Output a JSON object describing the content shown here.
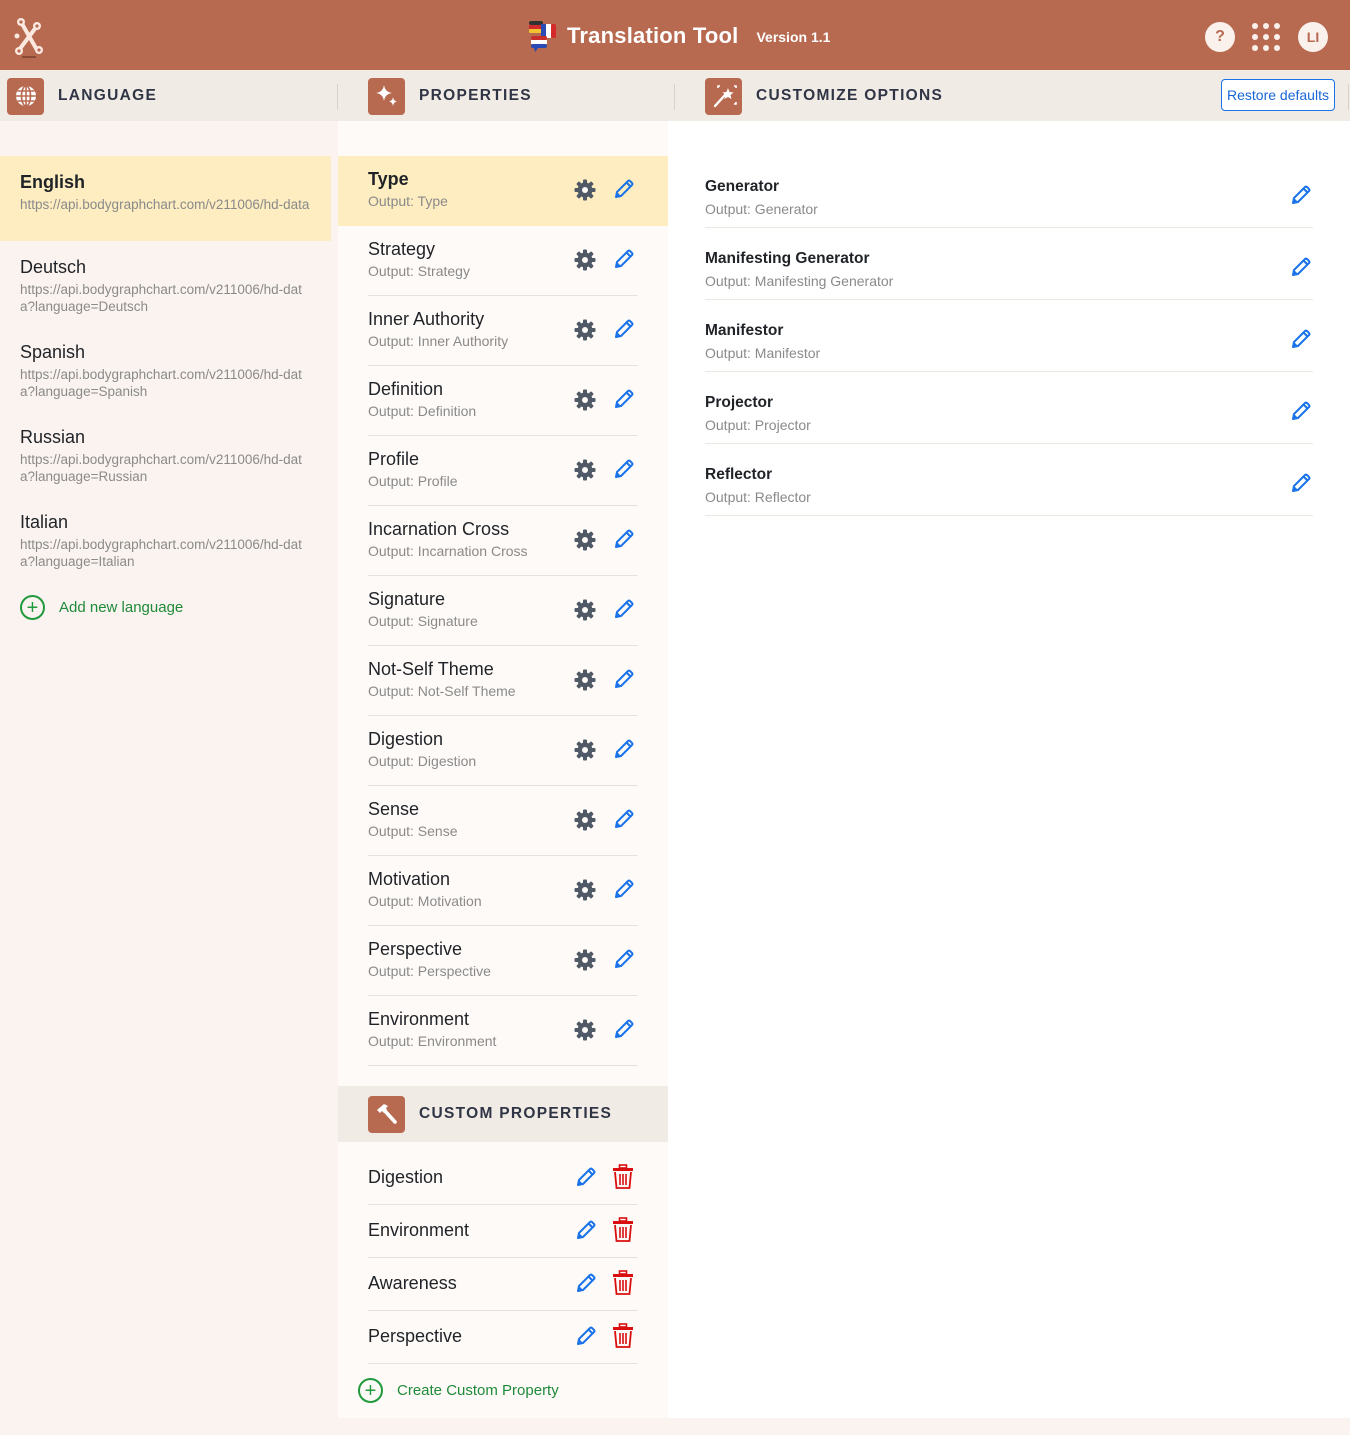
{
  "app": {
    "title": "Translation Tool",
    "version": "Version 1.1",
    "help_label": "?",
    "avatar_initials": "LI",
    "brand_color": "#b76a50"
  },
  "sections": {
    "language": {
      "title": "LANGUAGE",
      "icon": "globe-icon"
    },
    "properties": {
      "title": "PROPERTIES",
      "icon": "sparkles-icon"
    },
    "customize": {
      "title": "CUSTOMIZE OPTIONS",
      "icon": "magic-wand-icon",
      "restore_label": "Restore defaults"
    },
    "custom_properties": {
      "title": "CUSTOM PROPERTIES",
      "icon": "hammer-icon"
    }
  },
  "languages": [
    {
      "name": "English",
      "url": "https://api.bodygraphchart.com/v211006/hd-data",
      "selected": true
    },
    {
      "name": "Deutsch",
      "url": "https://api.bodygraphchart.com/v211006/hd-data?language=Deutsch",
      "selected": false
    },
    {
      "name": "Spanish",
      "url": "https://api.bodygraphchart.com/v211006/hd-data?language=Spanish",
      "selected": false
    },
    {
      "name": "Russian",
      "url": "https://api.bodygraphchart.com/v211006/hd-data?language=Russian",
      "selected": false
    },
    {
      "name": "Italian",
      "url": "https://api.bodygraphchart.com/v211006/hd-data?language=Italian",
      "selected": false
    }
  ],
  "add_language_label": "Add new language",
  "properties": [
    {
      "name": "Type",
      "output": "Output: Type",
      "selected": true
    },
    {
      "name": "Strategy",
      "output": "Output: Strategy"
    },
    {
      "name": "Inner Authority",
      "output": "Output: Inner Authority"
    },
    {
      "name": "Definition",
      "output": "Output: Definition"
    },
    {
      "name": "Profile",
      "output": "Output: Profile"
    },
    {
      "name": "Incarnation Cross",
      "output": "Output: Incarnation Cross"
    },
    {
      "name": "Signature",
      "output": "Output: Signature"
    },
    {
      "name": "Not-Self Theme",
      "output": "Output: Not-Self Theme"
    },
    {
      "name": "Digestion",
      "output": "Output: Digestion"
    },
    {
      "name": "Sense",
      "output": "Output: Sense"
    },
    {
      "name": "Motivation",
      "output": "Output: Motivation"
    },
    {
      "name": "Perspective",
      "output": "Output: Perspective"
    },
    {
      "name": "Environment",
      "output": "Output: Environment"
    }
  ],
  "custom_properties": [
    {
      "name": "Digestion"
    },
    {
      "name": "Environment"
    },
    {
      "name": "Awareness"
    },
    {
      "name": "Perspective"
    }
  ],
  "create_custom_label": "Create Custom Property",
  "options": [
    {
      "name": "Generator",
      "output": "Output: Generator"
    },
    {
      "name": "Manifesting Generator",
      "output": "Output: Manifesting Generator"
    },
    {
      "name": "Manifestor",
      "output": "Output: Manifestor"
    },
    {
      "name": "Projector",
      "output": "Output: Projector"
    },
    {
      "name": "Reflector",
      "output": "Output: Reflector"
    }
  ]
}
